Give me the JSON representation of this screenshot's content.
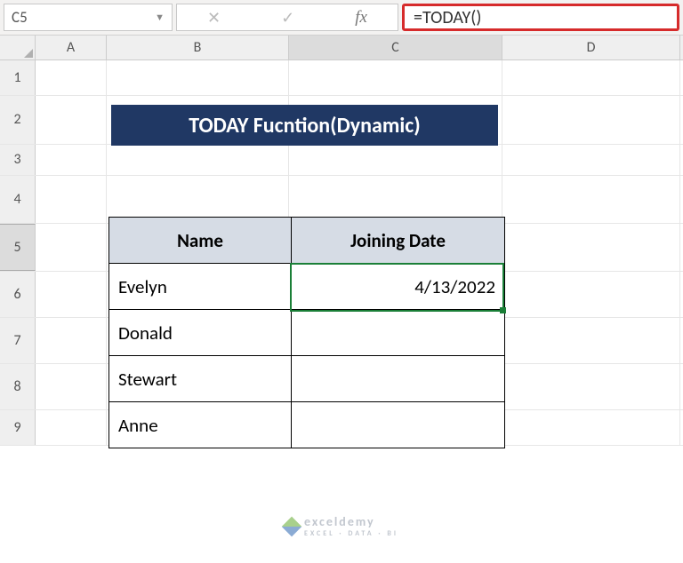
{
  "formula_bar": {
    "cell_ref": "C5",
    "formula": "=TODAY()"
  },
  "columns": [
    "A",
    "B",
    "C",
    "D"
  ],
  "rows": [
    "1",
    "2",
    "3",
    "4",
    "5",
    "6",
    "7",
    "8",
    "9"
  ],
  "title": "TODAY Fucntion(Dynamic)",
  "table": {
    "headers": {
      "name": "Name",
      "date": "Joining Date"
    },
    "rows": [
      {
        "name": "Evelyn",
        "date": "4/13/2022"
      },
      {
        "name": "Donald",
        "date": ""
      },
      {
        "name": "Stewart",
        "date": ""
      },
      {
        "name": "Anne",
        "date": ""
      }
    ]
  },
  "watermark": {
    "brand": "exceldemy",
    "tagline": "EXCEL · DATA · BI"
  }
}
